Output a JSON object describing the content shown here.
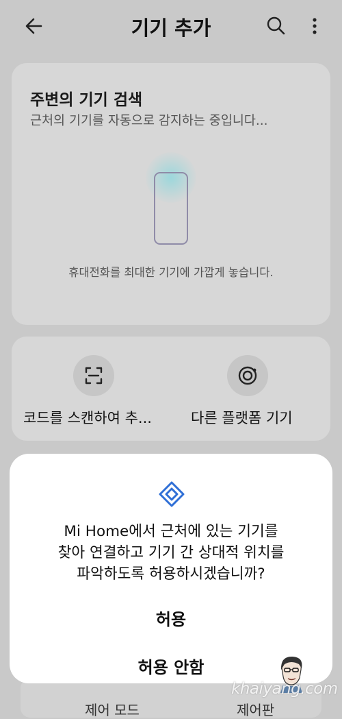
{
  "header": {
    "title": "기기 추가",
    "back_icon": "arrow-left-icon",
    "search_icon": "search-icon",
    "more_icon": "more-vertical-icon"
  },
  "scan_card": {
    "title": "주변의 기기 검색",
    "subtitle": "근처의 기기를 자동으로 감지하는 중입니다...",
    "hint": "휴대전화를 최대한 기기에 가깝게 놓습니다."
  },
  "options": [
    {
      "label": "코드를 스캔하여 추...",
      "icon": "scan-code-icon"
    },
    {
      "label": "다른 플랫폼 기기",
      "icon": "platform-icon"
    }
  ],
  "background_bottom": {
    "left_label": "제어 모드",
    "right_label": "제어판"
  },
  "dialog": {
    "icon": "nearby-diamond-icon",
    "message_lines": [
      "Mi Home에서 근처에 있는 기기를",
      "찾아 연결하고 기기 간 상대적 위치를",
      "파악하도록 허용하시겠습니까?"
    ],
    "allow_label": "허용",
    "deny_label": "허용 안함"
  },
  "watermark": "khaiyang.com",
  "colors": {
    "accent_blue": "#2f6fd6",
    "dim_background": "#c9c9c9",
    "dialog_background": "#ffffff"
  }
}
